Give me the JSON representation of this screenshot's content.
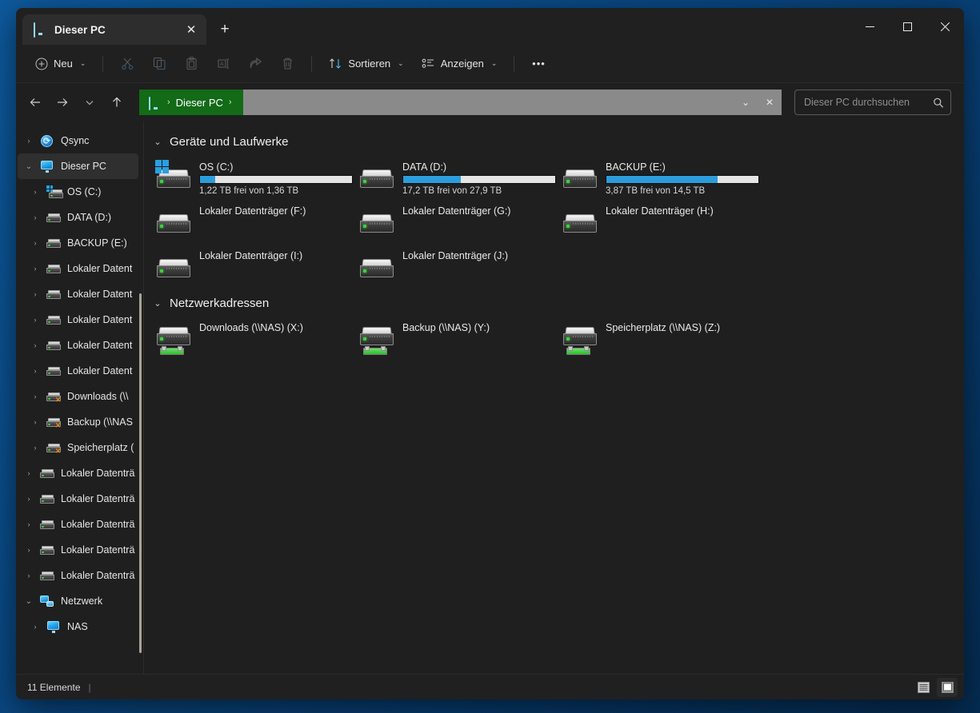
{
  "window": {
    "tab_title": "Dieser PC",
    "tab_close_glyph": "✕",
    "new_tab_glyph": "+",
    "minimize_label": "Minimieren",
    "maximize_label": "Maximieren",
    "close_label": "Schließen"
  },
  "commandbar": {
    "new_label": "Neu",
    "cut_label": "Ausschneiden",
    "copy_label": "Kopieren",
    "paste_label": "Einfügen",
    "rename_label": "Umbenennen",
    "share_label": "Freigeben",
    "delete_label": "Löschen",
    "sort_label": "Sortieren",
    "view_label": "Anzeigen",
    "more_label": "Mehr anzeigen",
    "more_glyph": "•••",
    "chevron_glyph": "⌄"
  },
  "navigation": {
    "back_label": "Zurück",
    "forward_label": "Vorwärts",
    "recent_label": "Zuletzt verwendete Speicherorte",
    "up_label": "Nach oben"
  },
  "address": {
    "crumb_label": "Dieser PC",
    "crumb_sep": "›",
    "crumb_lead_sep": "›",
    "dropdown_glyph": "⌄",
    "stop_glyph": "✕",
    "bar_color": "#8a8a8a",
    "crumb_color": "#136a17"
  },
  "search": {
    "placeholder": "Dieser PC durchsuchen",
    "value": "",
    "icon": "search-icon"
  },
  "sidebar": {
    "items": [
      {
        "label": "Qsync",
        "icon": "qsync-icon",
        "indent": 1,
        "expanded": false,
        "selected": false,
        "type": "cloud"
      },
      {
        "label": "Dieser PC",
        "icon": "this-pc-icon",
        "indent": 1,
        "expanded": true,
        "selected": true,
        "type": "pc"
      },
      {
        "label": "OS (C:)",
        "icon": "windows-drive-icon",
        "indent": 2,
        "expanded": false,
        "selected": false,
        "type": "osdrive"
      },
      {
        "label": "DATA (D:)",
        "icon": "drive-icon",
        "indent": 2,
        "expanded": false,
        "selected": false,
        "type": "drive"
      },
      {
        "label": "BACKUP (E:)",
        "icon": "drive-icon",
        "indent": 2,
        "expanded": false,
        "selected": false,
        "type": "drive"
      },
      {
        "label": "Lokaler Datent",
        "icon": "drive-icon",
        "indent": 2,
        "expanded": false,
        "selected": false,
        "type": "drive"
      },
      {
        "label": "Lokaler Datent",
        "icon": "drive-icon",
        "indent": 2,
        "expanded": false,
        "selected": false,
        "type": "drive"
      },
      {
        "label": "Lokaler Datent",
        "icon": "drive-icon",
        "indent": 2,
        "expanded": false,
        "selected": false,
        "type": "drive"
      },
      {
        "label": "Lokaler Datent",
        "icon": "drive-icon",
        "indent": 2,
        "expanded": false,
        "selected": false,
        "type": "drive"
      },
      {
        "label": "Lokaler Datent",
        "icon": "drive-icon",
        "indent": 2,
        "expanded": false,
        "selected": false,
        "type": "drive"
      },
      {
        "label": "Downloads (\\\\",
        "icon": "network-drive-disconnected-icon",
        "indent": 2,
        "expanded": false,
        "selected": false,
        "type": "netdrive"
      },
      {
        "label": "Backup (\\\\NAS",
        "icon": "network-drive-disconnected-icon",
        "indent": 2,
        "expanded": false,
        "selected": false,
        "type": "netdrive"
      },
      {
        "label": "Speicherplatz (",
        "icon": "network-drive-disconnected-icon",
        "indent": 2,
        "expanded": false,
        "selected": false,
        "type": "netdrive"
      },
      {
        "label": "Lokaler Datenträ",
        "icon": "drive-icon",
        "indent": 1,
        "expanded": false,
        "selected": false,
        "type": "drive"
      },
      {
        "label": "Lokaler Datenträ",
        "icon": "drive-icon",
        "indent": 1,
        "expanded": false,
        "selected": false,
        "type": "drive"
      },
      {
        "label": "Lokaler Datenträ",
        "icon": "drive-icon",
        "indent": 1,
        "expanded": false,
        "selected": false,
        "type": "drive"
      },
      {
        "label": "Lokaler Datenträ",
        "icon": "drive-icon",
        "indent": 1,
        "expanded": false,
        "selected": false,
        "type": "drive"
      },
      {
        "label": "Lokaler Datenträ",
        "icon": "drive-icon",
        "indent": 1,
        "expanded": false,
        "selected": false,
        "type": "drive"
      },
      {
        "label": "Netzwerk",
        "icon": "network-icon",
        "indent": 1,
        "expanded": true,
        "selected": false,
        "type": "network"
      },
      {
        "label": "NAS",
        "icon": "computer-icon",
        "indent": 2,
        "expanded": false,
        "selected": false,
        "type": "pc"
      }
    ],
    "expand_glyph": "›",
    "collapse_glyph": "⌄"
  },
  "content": {
    "groups": [
      {
        "title": "Geräte und Laufwerke",
        "collapse_glyph": "⌄",
        "items": [
          {
            "name": "OS (C:)",
            "type": "osdrive",
            "has_bar": true,
            "free_pct": 10,
            "sub": "1,22 TB frei von 1,36 TB"
          },
          {
            "name": "DATA (D:)",
            "type": "drive",
            "has_bar": true,
            "free_pct": 38,
            "sub": "17,2 TB frei von 27,9 TB"
          },
          {
            "name": "BACKUP (E:)",
            "type": "drive",
            "has_bar": true,
            "free_pct": 73,
            "sub": "3,87 TB frei von 14,5 TB"
          },
          {
            "name": "Lokaler Datenträger (F:)",
            "type": "drive",
            "has_bar": false,
            "free_pct": 0,
            "sub": ""
          },
          {
            "name": "Lokaler Datenträger (G:)",
            "type": "drive",
            "has_bar": false,
            "free_pct": 0,
            "sub": ""
          },
          {
            "name": "Lokaler Datenträger (H:)",
            "type": "drive",
            "has_bar": false,
            "free_pct": 0,
            "sub": ""
          },
          {
            "name": "Lokaler Datenträger (I:)",
            "type": "drive",
            "has_bar": false,
            "free_pct": 0,
            "sub": ""
          },
          {
            "name": "Lokaler Datenträger (J:)",
            "type": "drive",
            "has_bar": false,
            "free_pct": 0,
            "sub": ""
          }
        ]
      },
      {
        "title": "Netzwerkadressen",
        "collapse_glyph": "⌄",
        "items": [
          {
            "name": "Downloads (\\\\NAS) (X:)",
            "type": "netdrive",
            "has_bar": false,
            "free_pct": 0,
            "sub": ""
          },
          {
            "name": "Backup (\\\\NAS) (Y:)",
            "type": "netdrive",
            "has_bar": false,
            "free_pct": 0,
            "sub": ""
          },
          {
            "name": "Speicherplatz (\\\\NAS) (Z:)",
            "type": "netdrive",
            "has_bar": false,
            "free_pct": 0,
            "sub": ""
          }
        ]
      }
    ]
  },
  "statusbar": {
    "item_count": "11 Elemente",
    "separator": "|",
    "details_view_label": "Detailansicht",
    "large_icons_view_label": "Große Symbole"
  },
  "colors": {
    "accent_blue": "#2c9ddb",
    "breadcrumb_green": "#136a17",
    "address_gray": "#8a8a8a",
    "window_bg": "#1f1f1f",
    "titlebar_bg": "#202020"
  }
}
